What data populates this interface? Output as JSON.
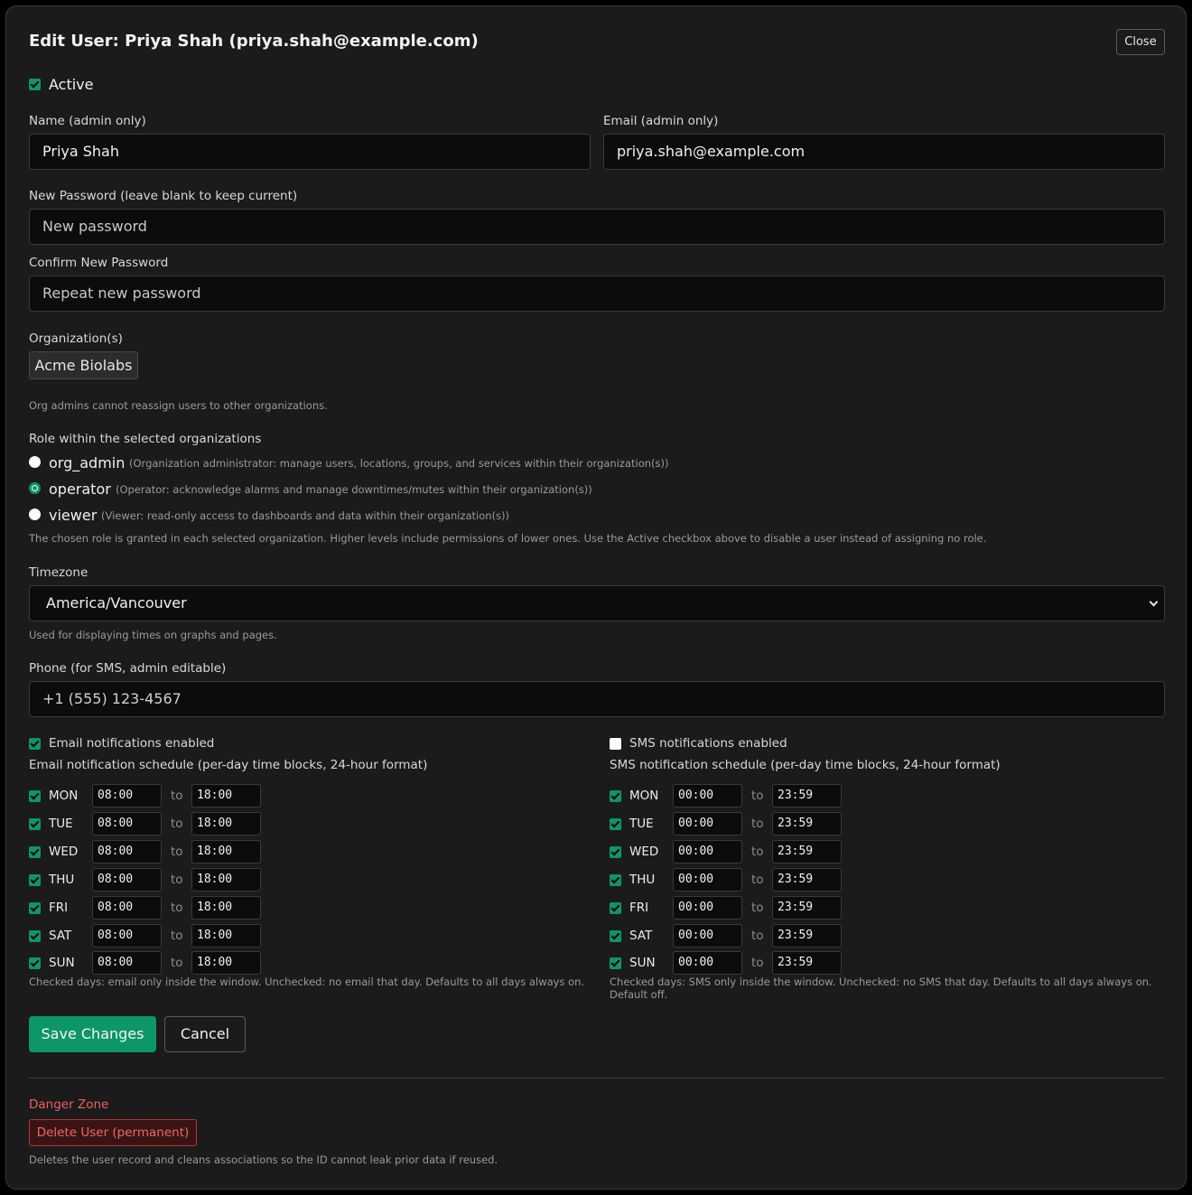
{
  "dialog": {
    "title": "Edit User: Priya Shah (priya.shah@example.com)",
    "close_label": "Close"
  },
  "active": {
    "label": "Active",
    "checked": true
  },
  "name": {
    "label": "Name (admin only)",
    "value": "Priya Shah"
  },
  "email": {
    "label": "Email (admin only)",
    "value": "priya.shah@example.com"
  },
  "new_password": {
    "label": "New Password (leave blank to keep current)",
    "placeholder": "New password"
  },
  "confirm_password": {
    "label": "Confirm New Password",
    "placeholder": "Repeat new password"
  },
  "organizations": {
    "label": "Organization(s)",
    "items": [
      "Acme Biolabs"
    ],
    "help": "Org admins cannot reassign users to other organizations."
  },
  "role": {
    "label": "Role within the selected organizations",
    "options": [
      {
        "name": "org_admin",
        "desc": "(Organization administrator: manage users, locations, groups, and services within their organization(s))",
        "selected": false
      },
      {
        "name": "operator",
        "desc": "(Operator: acknowledge alarms and manage downtimes/mutes within their organization(s))",
        "selected": true
      },
      {
        "name": "viewer",
        "desc": "(Viewer: read-only access to dashboards and data within their organization(s))",
        "selected": false
      }
    ],
    "help": "The chosen role is granted in each selected organization. Higher levels include permissions of lower ones. Use the Active checkbox above to disable a user instead of assigning no role."
  },
  "timezone": {
    "label": "Timezone",
    "value": "America/Vancouver",
    "help": "Used for displaying times on graphs and pages."
  },
  "phone": {
    "label": "Phone (for SMS, admin editable)",
    "value": "+1 (555) 123-4567"
  },
  "email_notifications": {
    "enabled_label": "Email notifications enabled",
    "enabled": true,
    "schedule_label": "Email notification schedule (per-day time blocks, 24-hour format)",
    "to_label": "to",
    "days": [
      {
        "day": "MON",
        "from": "08:00",
        "to": "18:00"
      },
      {
        "day": "TUE",
        "from": "08:00",
        "to": "18:00"
      },
      {
        "day": "WED",
        "from": "08:00",
        "to": "18:00"
      },
      {
        "day": "THU",
        "from": "08:00",
        "to": "18:00"
      },
      {
        "day": "FRI",
        "from": "08:00",
        "to": "18:00"
      },
      {
        "day": "SAT",
        "from": "08:00",
        "to": "18:00"
      },
      {
        "day": "SUN",
        "from": "08:00",
        "to": "18:00"
      }
    ],
    "help": "Checked days: email only inside the window. Unchecked: no email that day. Defaults to all days always on."
  },
  "sms_notifications": {
    "enabled_label": "SMS notifications enabled",
    "enabled": false,
    "schedule_label": "SMS notification schedule (per-day time blocks, 24-hour format)",
    "to_label": "to",
    "days": [
      {
        "day": "MON",
        "from": "00:00",
        "to": "23:59"
      },
      {
        "day": "TUE",
        "from": "00:00",
        "to": "23:59"
      },
      {
        "day": "WED",
        "from": "00:00",
        "to": "23:59"
      },
      {
        "day": "THU",
        "from": "00:00",
        "to": "23:59"
      },
      {
        "day": "FRI",
        "from": "00:00",
        "to": "23:59"
      },
      {
        "day": "SAT",
        "from": "00:00",
        "to": "23:59"
      },
      {
        "day": "SUN",
        "from": "00:00",
        "to": "23:59"
      }
    ],
    "help": "Checked days: SMS only inside the window. Unchecked: no SMS that day. Defaults to all days always on. Default off."
  },
  "actions": {
    "save_label": "Save Changes",
    "cancel_label": "Cancel"
  },
  "danger": {
    "title": "Danger Zone",
    "delete_label": "Delete User (permanent)",
    "help": "Deletes the user record and cleans associations so the ID cannot leak prior data if reused."
  },
  "colors": {
    "accent": "#0d9668",
    "danger": "#f06060",
    "background": "#1b1b1c"
  }
}
